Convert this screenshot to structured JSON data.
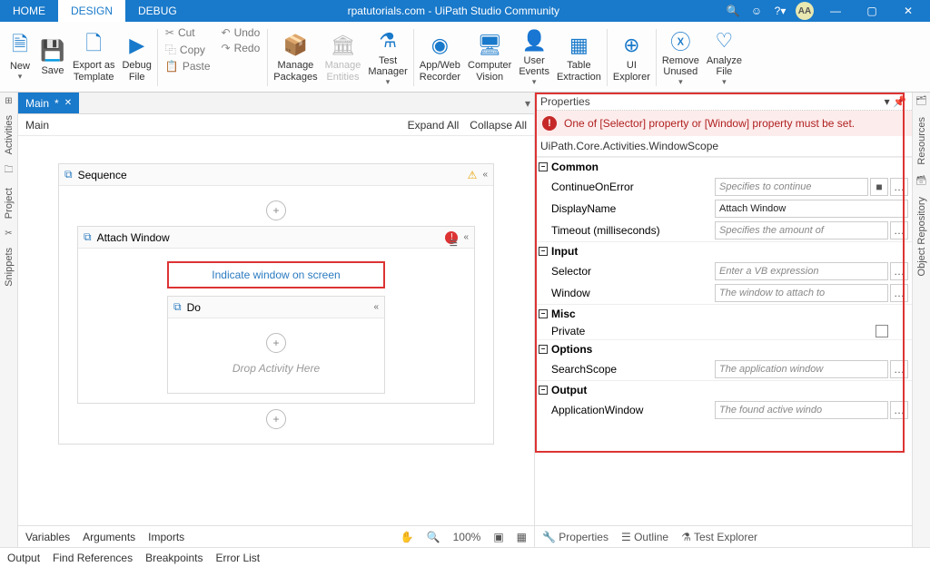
{
  "title": "rpatutorials.com - UiPath Studio Community",
  "tabs": {
    "home": "HOME",
    "design": "DESIGN",
    "debug": "DEBUG"
  },
  "avatar": "AA",
  "ribbon": {
    "new": "New",
    "save": "Save",
    "export": "Export as\nTemplate",
    "debug": "Debug\nFile",
    "cut": "Cut",
    "copy": "Copy",
    "paste": "Paste",
    "undo": "Undo",
    "redo": "Redo",
    "mpackages": "Manage\nPackages",
    "mentities": "Manage\nEntities",
    "testmgr": "Test\nManager",
    "recorder": "App/Web\nRecorder",
    "cv": "Computer\nVision",
    "uevents": "User\nEvents",
    "textract": "Table\nExtraction",
    "uiexp": "UI\nExplorer",
    "remunused": "Remove\nUnused",
    "analyze": "Analyze\nFile"
  },
  "rail": {
    "activities": "Activities",
    "project": "Project",
    "snippets": "Snippets",
    "resources": "Resources",
    "objrepo": "Object Repository"
  },
  "doc": {
    "tab": "Main",
    "dirty": "*",
    "breadcrumb": "Main",
    "expand": "Expand All",
    "collapse": "Collapse All"
  },
  "workflow": {
    "sequence": "Sequence",
    "attach": "Attach Window",
    "indicate": "Indicate window on screen",
    "do": "Do",
    "drop": "Drop Activity Here"
  },
  "props": {
    "title": "Properties",
    "error": "One of [Selector] property or [Window] property must be set.",
    "cls": "UiPath.Core.Activities.WindowScope",
    "cat_common": "Common",
    "continueOnError": "ContinueOnError",
    "continueOnError_ph": "Specifies to continue",
    "displayName": "DisplayName",
    "displayName_val": "Attach Window",
    "timeout": "Timeout (milliseconds)",
    "timeout_ph": "Specifies the amount of",
    "cat_input": "Input",
    "selector": "Selector",
    "selector_ph": "Enter a VB expression",
    "window": "Window",
    "window_ph": "The window to attach to",
    "cat_misc": "Misc",
    "private": "Private",
    "cat_options": "Options",
    "searchScope": "SearchScope",
    "searchScope_ph": "The application window",
    "cat_output": "Output",
    "appWindow": "ApplicationWindow",
    "appWindow_ph": "The found active windo"
  },
  "bottom": {
    "variables": "Variables",
    "arguments": "Arguments",
    "imports": "Imports",
    "zoom": "100%",
    "properties": "Properties",
    "outline": "Outline",
    "testexp": "Test Explorer",
    "output": "Output",
    "findref": "Find References",
    "breakpoints": "Breakpoints",
    "errorlist": "Error List"
  }
}
